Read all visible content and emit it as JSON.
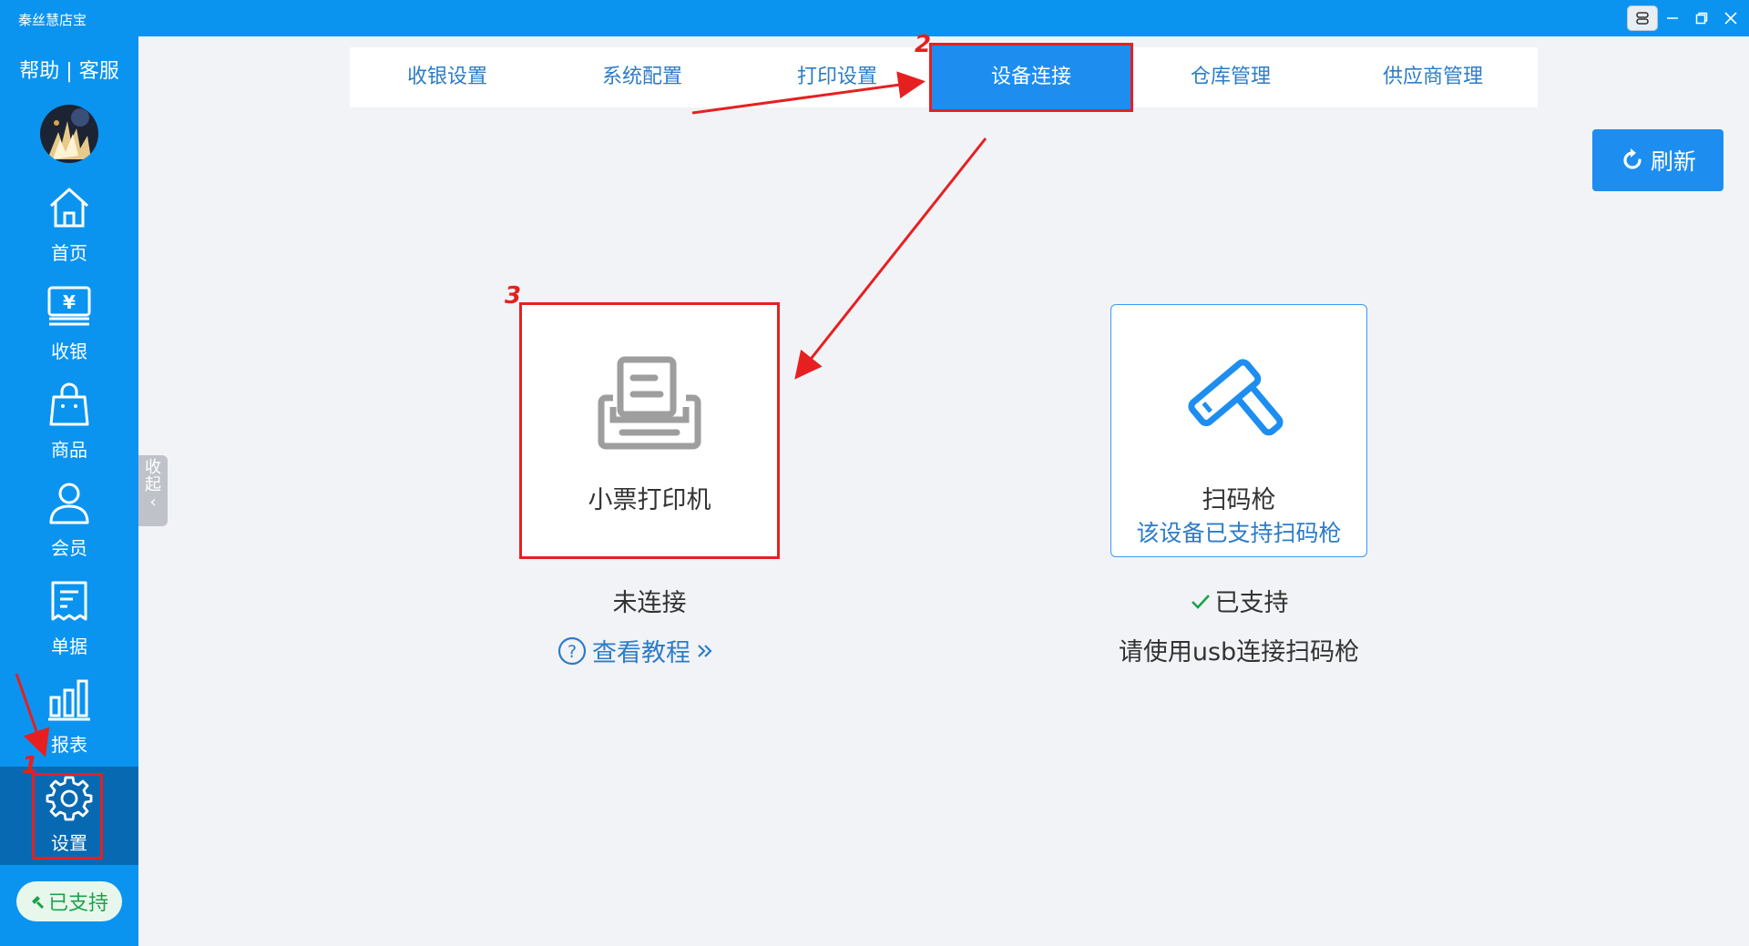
{
  "window": {
    "title": "秦丝慧店宝"
  },
  "sidebar": {
    "help": "帮助",
    "separator": "|",
    "service": "客服",
    "items": [
      {
        "label": "首页",
        "icon": "home-icon"
      },
      {
        "label": "收银",
        "icon": "cashier-icon"
      },
      {
        "label": "商品",
        "icon": "shopping-bag-icon"
      },
      {
        "label": "会员",
        "icon": "user-icon"
      },
      {
        "label": "单据",
        "icon": "receipt-icon"
      },
      {
        "label": "报表",
        "icon": "bar-chart-icon"
      },
      {
        "label": "设置",
        "icon": "gear-icon"
      }
    ],
    "active_item": "设置",
    "support_pill": "已支持",
    "collapse_label": [
      "收",
      "起",
      "‹"
    ]
  },
  "tabs": [
    {
      "label": "收银设置"
    },
    {
      "label": "系统配置"
    },
    {
      "label": "打印设置"
    },
    {
      "label": "设备连接"
    },
    {
      "label": "仓库管理"
    },
    {
      "label": "供应商管理"
    }
  ],
  "active_tab": "设备连接",
  "refresh_button": "刷新",
  "devices": {
    "printer": {
      "title": "小票打印机",
      "status": "未连接",
      "tutorial_link": "查看教程",
      "icon": "printer-icon"
    },
    "scanner": {
      "title": "扫码枪",
      "subtitle": "该设备已支持扫码枪",
      "status": "已支持",
      "hint": "请使用usb连接扫码枪",
      "icon": "barcode-scanner-icon"
    }
  },
  "annotations": [
    "1",
    "2",
    "3"
  ],
  "colors": {
    "primary": "#0a94f0",
    "active_sidebar": "#0869b3",
    "accent_button": "#1d8ef0",
    "link": "#2d7cc7",
    "annotation_red": "#e62020",
    "success_green": "#1aa34a"
  }
}
